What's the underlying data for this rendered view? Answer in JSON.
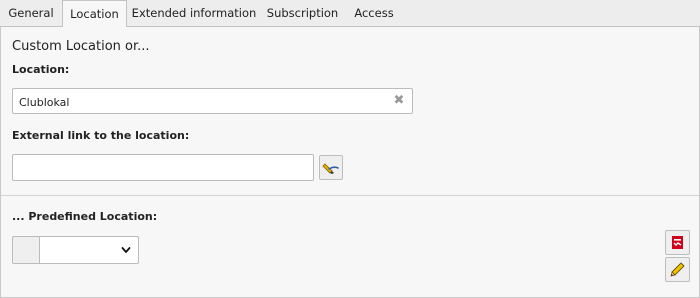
{
  "tabs": [
    {
      "label": "General",
      "active": false
    },
    {
      "label": "Location",
      "active": true
    },
    {
      "label": "Extended information",
      "active": false
    },
    {
      "label": "Subscription",
      "active": false
    },
    {
      "label": "Access",
      "active": false
    }
  ],
  "form": {
    "heading": "Custom Location or...",
    "location_label": "Location:",
    "location_value": "Clublokal",
    "external_link_label": "External link to the location:",
    "external_link_value": "",
    "predefined_label": "... Predefined Location:",
    "predefined_selected": ""
  },
  "icons": {
    "clear": "clear-icon",
    "link_wizard": "link-wizard-icon",
    "record_add": "record-add-icon",
    "edit": "pencil-icon",
    "select": "chevron-down-icon"
  },
  "colors": {
    "accent_red": "#d0021b",
    "pencil_yellow": "#f2c200"
  }
}
